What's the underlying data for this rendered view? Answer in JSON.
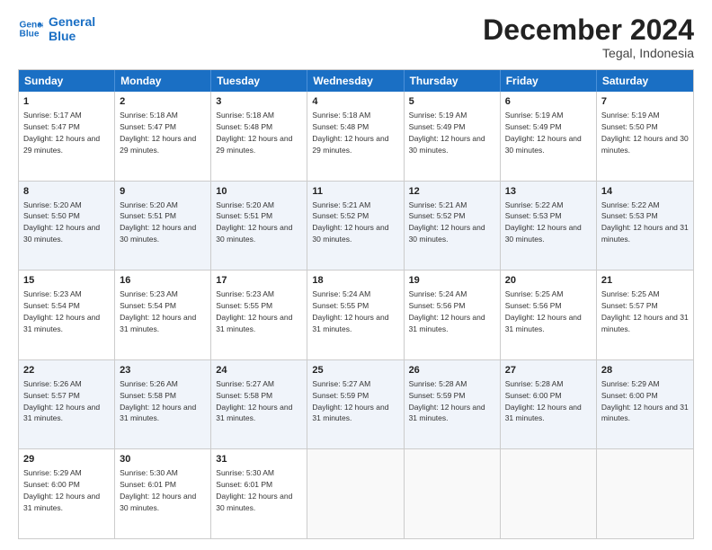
{
  "logo": {
    "line1": "General",
    "line2": "Blue"
  },
  "title": "December 2024",
  "location": "Tegal, Indonesia",
  "weekdays": [
    "Sunday",
    "Monday",
    "Tuesday",
    "Wednesday",
    "Thursday",
    "Friday",
    "Saturday"
  ],
  "weeks": [
    [
      {
        "day": "1",
        "sunrise": "5:17 AM",
        "sunset": "5:47 PM",
        "daylight": "12 hours and 29 minutes."
      },
      {
        "day": "2",
        "sunrise": "5:18 AM",
        "sunset": "5:47 PM",
        "daylight": "12 hours and 29 minutes."
      },
      {
        "day": "3",
        "sunrise": "5:18 AM",
        "sunset": "5:48 PM",
        "daylight": "12 hours and 29 minutes."
      },
      {
        "day": "4",
        "sunrise": "5:18 AM",
        "sunset": "5:48 PM",
        "daylight": "12 hours and 29 minutes."
      },
      {
        "day": "5",
        "sunrise": "5:19 AM",
        "sunset": "5:49 PM",
        "daylight": "12 hours and 30 minutes."
      },
      {
        "day": "6",
        "sunrise": "5:19 AM",
        "sunset": "5:49 PM",
        "daylight": "12 hours and 30 minutes."
      },
      {
        "day": "7",
        "sunrise": "5:19 AM",
        "sunset": "5:50 PM",
        "daylight": "12 hours and 30 minutes."
      }
    ],
    [
      {
        "day": "8",
        "sunrise": "5:20 AM",
        "sunset": "5:50 PM",
        "daylight": "12 hours and 30 minutes."
      },
      {
        "day": "9",
        "sunrise": "5:20 AM",
        "sunset": "5:51 PM",
        "daylight": "12 hours and 30 minutes."
      },
      {
        "day": "10",
        "sunrise": "5:20 AM",
        "sunset": "5:51 PM",
        "daylight": "12 hours and 30 minutes."
      },
      {
        "day": "11",
        "sunrise": "5:21 AM",
        "sunset": "5:52 PM",
        "daylight": "12 hours and 30 minutes."
      },
      {
        "day": "12",
        "sunrise": "5:21 AM",
        "sunset": "5:52 PM",
        "daylight": "12 hours and 30 minutes."
      },
      {
        "day": "13",
        "sunrise": "5:22 AM",
        "sunset": "5:53 PM",
        "daylight": "12 hours and 30 minutes."
      },
      {
        "day": "14",
        "sunrise": "5:22 AM",
        "sunset": "5:53 PM",
        "daylight": "12 hours and 31 minutes."
      }
    ],
    [
      {
        "day": "15",
        "sunrise": "5:23 AM",
        "sunset": "5:54 PM",
        "daylight": "12 hours and 31 minutes."
      },
      {
        "day": "16",
        "sunrise": "5:23 AM",
        "sunset": "5:54 PM",
        "daylight": "12 hours and 31 minutes."
      },
      {
        "day": "17",
        "sunrise": "5:23 AM",
        "sunset": "5:55 PM",
        "daylight": "12 hours and 31 minutes."
      },
      {
        "day": "18",
        "sunrise": "5:24 AM",
        "sunset": "5:55 PM",
        "daylight": "12 hours and 31 minutes."
      },
      {
        "day": "19",
        "sunrise": "5:24 AM",
        "sunset": "5:56 PM",
        "daylight": "12 hours and 31 minutes."
      },
      {
        "day": "20",
        "sunrise": "5:25 AM",
        "sunset": "5:56 PM",
        "daylight": "12 hours and 31 minutes."
      },
      {
        "day": "21",
        "sunrise": "5:25 AM",
        "sunset": "5:57 PM",
        "daylight": "12 hours and 31 minutes."
      }
    ],
    [
      {
        "day": "22",
        "sunrise": "5:26 AM",
        "sunset": "5:57 PM",
        "daylight": "12 hours and 31 minutes."
      },
      {
        "day": "23",
        "sunrise": "5:26 AM",
        "sunset": "5:58 PM",
        "daylight": "12 hours and 31 minutes."
      },
      {
        "day": "24",
        "sunrise": "5:27 AM",
        "sunset": "5:58 PM",
        "daylight": "12 hours and 31 minutes."
      },
      {
        "day": "25",
        "sunrise": "5:27 AM",
        "sunset": "5:59 PM",
        "daylight": "12 hours and 31 minutes."
      },
      {
        "day": "26",
        "sunrise": "5:28 AM",
        "sunset": "5:59 PM",
        "daylight": "12 hours and 31 minutes."
      },
      {
        "day": "27",
        "sunrise": "5:28 AM",
        "sunset": "6:00 PM",
        "daylight": "12 hours and 31 minutes."
      },
      {
        "day": "28",
        "sunrise": "5:29 AM",
        "sunset": "6:00 PM",
        "daylight": "12 hours and 31 minutes."
      }
    ],
    [
      {
        "day": "29",
        "sunrise": "5:29 AM",
        "sunset": "6:00 PM",
        "daylight": "12 hours and 31 minutes."
      },
      {
        "day": "30",
        "sunrise": "5:30 AM",
        "sunset": "6:01 PM",
        "daylight": "12 hours and 30 minutes."
      },
      {
        "day": "31",
        "sunrise": "5:30 AM",
        "sunset": "6:01 PM",
        "daylight": "12 hours and 30 minutes."
      },
      null,
      null,
      null,
      null
    ]
  ]
}
